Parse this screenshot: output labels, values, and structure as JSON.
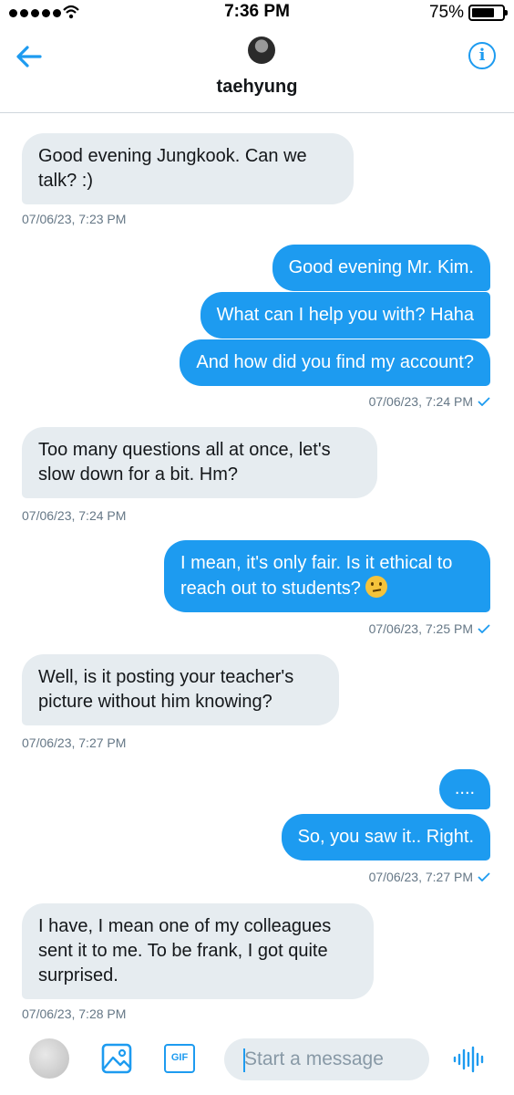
{
  "status_bar": {
    "time": "7:36 PM",
    "battery": "75%",
    "battery_level": 0.75
  },
  "header": {
    "contact_name": "taehyung",
    "back_icon": "arrow-left-icon",
    "info_icon": "info-icon",
    "info_glyph": "i"
  },
  "messages": [
    {
      "direction": "in",
      "text": "Good evening Jungkook. Can we talk? :)"
    },
    {
      "timestamp": "07/06/23, 7:23 PM"
    },
    {
      "direction": "out",
      "text": "Good evening Mr. Kim."
    },
    {
      "direction": "out",
      "text": "What can I help you with? Haha"
    },
    {
      "direction": "out",
      "text": "And how did you find my account?"
    },
    {
      "timestamp": "07/06/23, 7:24 PM",
      "read": true
    },
    {
      "direction": "in",
      "text": "Too many questions all at once, let's slow down for a bit. Hm?"
    },
    {
      "timestamp": "07/06/23, 7:24 PM"
    },
    {
      "direction": "out",
      "text": "I mean, it's only fair. Is it ethical to reach out to students?",
      "emoji": "thinking-face"
    },
    {
      "timestamp": "07/06/23, 7:25 PM",
      "read": true
    },
    {
      "direction": "in",
      "text": "Well, is it posting your teacher's picture without him knowing?"
    },
    {
      "timestamp": "07/06/23, 7:27 PM"
    },
    {
      "direction": "out",
      "text": "...."
    },
    {
      "direction": "out",
      "text": "So, you saw it.. Right."
    },
    {
      "timestamp": "07/06/23, 7:27 PM",
      "read": true
    },
    {
      "direction": "in",
      "text": "I have, I mean one of my colleagues sent it to me. To be frank, I got quite surprised."
    },
    {
      "timestamp": "07/06/23, 7:28 PM"
    }
  ],
  "composer": {
    "placeholder": "Start a message",
    "gif_label": "GIF",
    "image_icon": "image-icon",
    "voice_icon": "voice-waveform-icon"
  },
  "colors": {
    "accent": "#1d9bf0",
    "incoming_bubble": "#e6ecf0",
    "timestamp": "#657786"
  }
}
